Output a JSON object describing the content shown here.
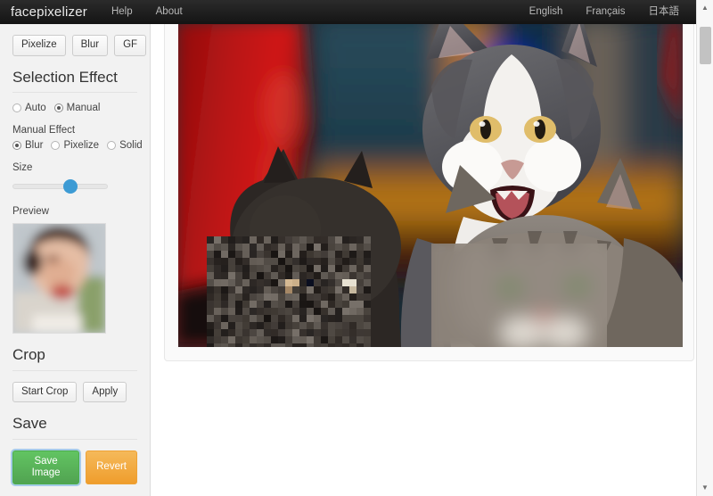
{
  "navbar": {
    "brand": "facepixelizer",
    "left_links": [
      {
        "label": "Help",
        "name": "nav-link-help"
      },
      {
        "label": "About",
        "name": "nav-link-about"
      }
    ],
    "right_links": [
      {
        "label": "English",
        "name": "nav-link-english"
      },
      {
        "label": "Français",
        "name": "nav-link-francais"
      },
      {
        "label": "日本語",
        "name": "nav-link-japanese"
      }
    ]
  },
  "sidebar": {
    "tool_buttons": [
      {
        "label": "Pixelize"
      },
      {
        "label": "Blur"
      },
      {
        "label": "GF"
      }
    ],
    "selection_effect": {
      "title": "Selection Effect",
      "mode_options": [
        {
          "label": "Auto",
          "selected": false
        },
        {
          "label": "Manual",
          "selected": true
        }
      ],
      "manual_effect_label": "Manual Effect",
      "manual_effect_options": [
        {
          "label": "Blur",
          "selected": true
        },
        {
          "label": "Pixelize",
          "selected": false
        },
        {
          "label": "Solid",
          "selected": false
        }
      ],
      "size_label": "Size",
      "size_value": 55,
      "preview_label": "Preview"
    },
    "crop": {
      "title": "Crop",
      "start_label": "Start Crop",
      "apply_label": "Apply"
    },
    "save": {
      "title": "Save",
      "save_label": "Save Image",
      "revert_label": "Revert"
    }
  },
  "colors": {
    "accent_blue": "#3d9bd4",
    "save_green": "#51a351",
    "revert_orange": "#ef9d2c",
    "navbar_dark": "#1f1f1f",
    "sidebar_bg": "#f2f2f2"
  },
  "scrollbar": {
    "up_arrow": "▲",
    "down_arrow": "▼"
  },
  "image": {
    "description": "Three kittens photo; center kitten face visible, left dark kitten face pixelized, right tabby kitten face blurred"
  }
}
